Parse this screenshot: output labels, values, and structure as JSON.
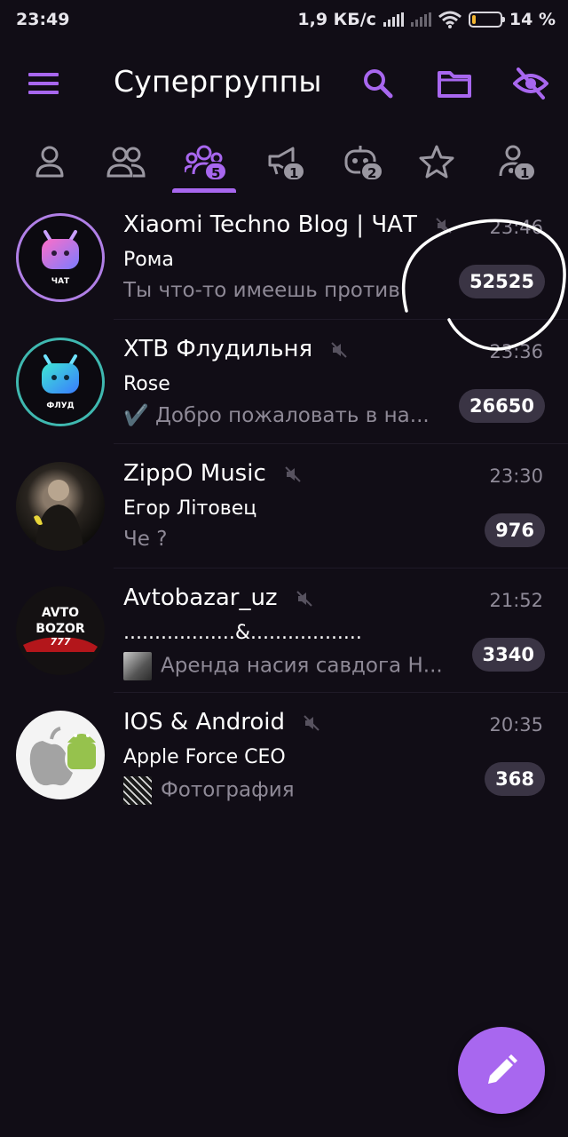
{
  "status_bar": {
    "time": "23:49",
    "network_speed": "1,9 КБ/с",
    "battery": "14 %",
    "battery_level": 0.14
  },
  "toolbar": {
    "title": "Супергруппы",
    "icons": [
      "menu-icon",
      "search-icon",
      "folder-icon",
      "eye-off-icon"
    ]
  },
  "tabs": [
    {
      "name": "users",
      "badge": ""
    },
    {
      "name": "groups",
      "badge": ""
    },
    {
      "name": "supergroups",
      "badge": "5",
      "active": true
    },
    {
      "name": "channels",
      "badge": "1"
    },
    {
      "name": "bots",
      "badge": "2"
    },
    {
      "name": "favorites",
      "badge": ""
    },
    {
      "name": "admin",
      "badge": "1"
    }
  ],
  "chats": [
    {
      "name": "Xiaomi Techno Blog | ЧАТ",
      "time": "23:46",
      "sender": "Рома",
      "preview": "Ты что-то имеешь против",
      "unread": "52525",
      "avatar_label": "ЧАТ",
      "muted": true
    },
    {
      "name": "XTB Флудильня",
      "time": "23:36",
      "sender": "Rose",
      "preview": "✔️ Добро пожаловать в на...",
      "unread": "26650",
      "avatar_label": "ФЛУД",
      "muted": true
    },
    {
      "name": "ZippO Music",
      "time": "23:30",
      "sender": "Егор Літовец",
      "preview": "Че ?",
      "unread": "976",
      "muted": true
    },
    {
      "name": "Avtobazar_uz",
      "time": "21:52",
      "sender": "..................&..................",
      "preview": "Аренда насия савдога Н...",
      "unread": "3340",
      "avatar_label_1": "AVTO",
      "avatar_label_2": "BOZOR",
      "avatar_label_3": "777",
      "muted": true
    },
    {
      "name": "IOS & Android",
      "time": "20:35",
      "sender": "Apple Force CEO",
      "preview": "Фотография",
      "unread": "368",
      "muted": true
    }
  ],
  "colors": {
    "accent": "#a867ef",
    "background": "#110d16",
    "badge_bg": "#3a3444",
    "muted_text": "#8e8996"
  },
  "fab": {
    "icon": "pencil-icon"
  }
}
